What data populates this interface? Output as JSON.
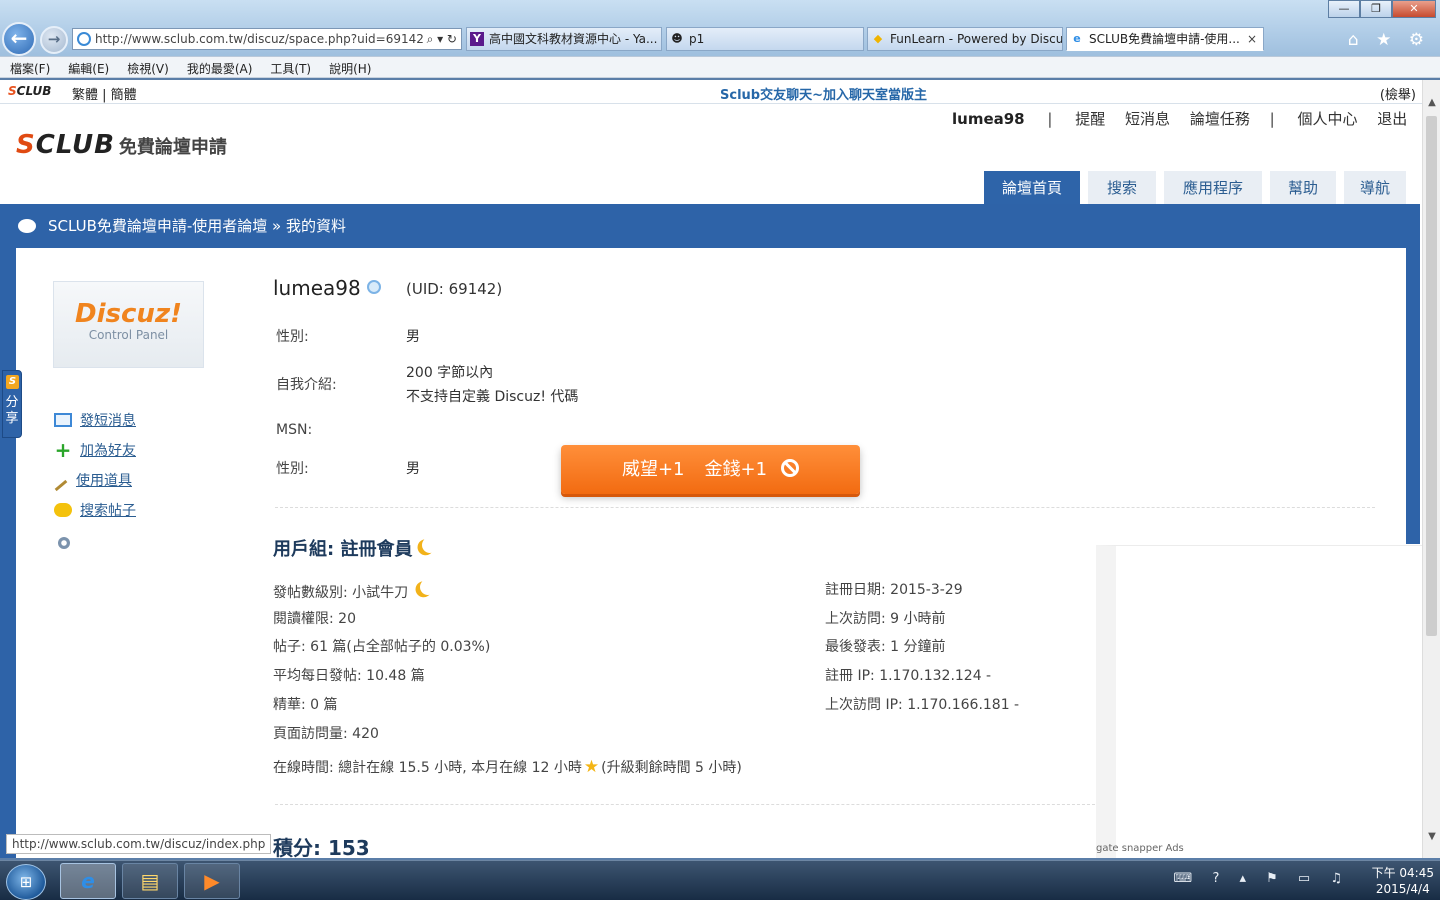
{
  "browser": {
    "window_buttons": [
      "—",
      "❐",
      "✕"
    ],
    "address": "http://www.sclub.com.tw/discuz/space.php?uid=69142",
    "address_tools": "⌕ ▾ ↻",
    "tabs": [
      {
        "label": "高中國文科教材資源中心 - Ya...",
        "icon": "Y"
      },
      {
        "label": "p1",
        "icon": "☻"
      },
      {
        "label": "FunLearn - Powered by Discuz!",
        "icon": "◆"
      },
      {
        "label": "SCLUB免費論壇申請-使用...",
        "icon": "e",
        "close": "×"
      }
    ],
    "toolbar_icons": "⌂ ★ ⚙",
    "menu": [
      "檔案(F)",
      "編輯(E)",
      "檢視(V)",
      "我的最愛(A)",
      "工具(T)",
      "說明(H)"
    ],
    "status_url": "http://www.sclub.com.tw/discuz/index.php"
  },
  "topbar": {
    "mini_logo_s": "S",
    "mini_logo_rest": "CLUB",
    "lang": "繁體 | 簡體",
    "promo": "Sclub交友聊天~加入聊天室當版主",
    "check": "(檢舉)"
  },
  "logo": {
    "s": "S",
    "rest": "CLUB",
    "sub": "免費論壇申請"
  },
  "user_nav": {
    "username": "lumea98",
    "sep": "|",
    "links": [
      "提醒",
      "短消息",
      "論壇任務"
    ],
    "links2": [
      "個人中心",
      "退出"
    ]
  },
  "nav_tabs": [
    "論壇首頁",
    "搜索",
    "應用程序",
    "幫助",
    "導航"
  ],
  "breadcrumb": "SCLUB免費論壇申請-使用者論壇 » 我的資料",
  "share": {
    "s": "S",
    "label": "分享"
  },
  "sidebar": {
    "avatar_line1": "Discuz!",
    "avatar_line2": "Control Panel",
    "items": [
      "發短消息",
      "加為好友",
      "使用道具",
      "搜索帖子"
    ]
  },
  "profile": {
    "username": "lumea98",
    "uid": "(UID: 69142)",
    "gender_label": "性別:",
    "gender": "男",
    "intro_label": "自我介紹:",
    "intro_line1": "200 字節以內",
    "intro_line2": "不支持自定義 Discuz! 代碼",
    "msn_label": "MSN:",
    "gender2_label": "性別:",
    "gender2": "男"
  },
  "reward_button": {
    "prestige": "威望+1",
    "money": "金錢+1"
  },
  "group": {
    "title": "用戶組: 註冊會員",
    "left": {
      "post_level": "發帖數級別: 小試牛刀",
      "read_perm": "閱讀權限: 20",
      "posts": "帖子: 61 篇(占全部帖子的 0.03%)",
      "daily_posts": "平均每日發帖: 10.48 篇",
      "digest": "精華: 0 篇",
      "page_views": "頁面訪問量: 420"
    },
    "right": {
      "reg_date": "註冊日期: 2015-3-29",
      "last_visit": "上次訪問: 9 小時前",
      "last_post": "最後發表: 1 分鐘前",
      "reg_ip": "註冊 IP: 1.170.132.124 -",
      "last_ip": "上次訪問 IP: 1.170.166.181 -"
    },
    "online_time": "在線時間: 總計在線 15.5 小時, 本月在線 12 小時",
    "online_time_tail": "(升級剩餘時間 5 小時)"
  },
  "credits": "積分: 153",
  "ads_label": "gate snapper Ads",
  "taskbar": {
    "start": "⊞",
    "items": [
      "e",
      "▤",
      "▶"
    ],
    "tray_icons": "⌨ ? ▴ ⚑ ▭ ♫",
    "time": "下午 04:45",
    "date": "2015/4/4"
  }
}
